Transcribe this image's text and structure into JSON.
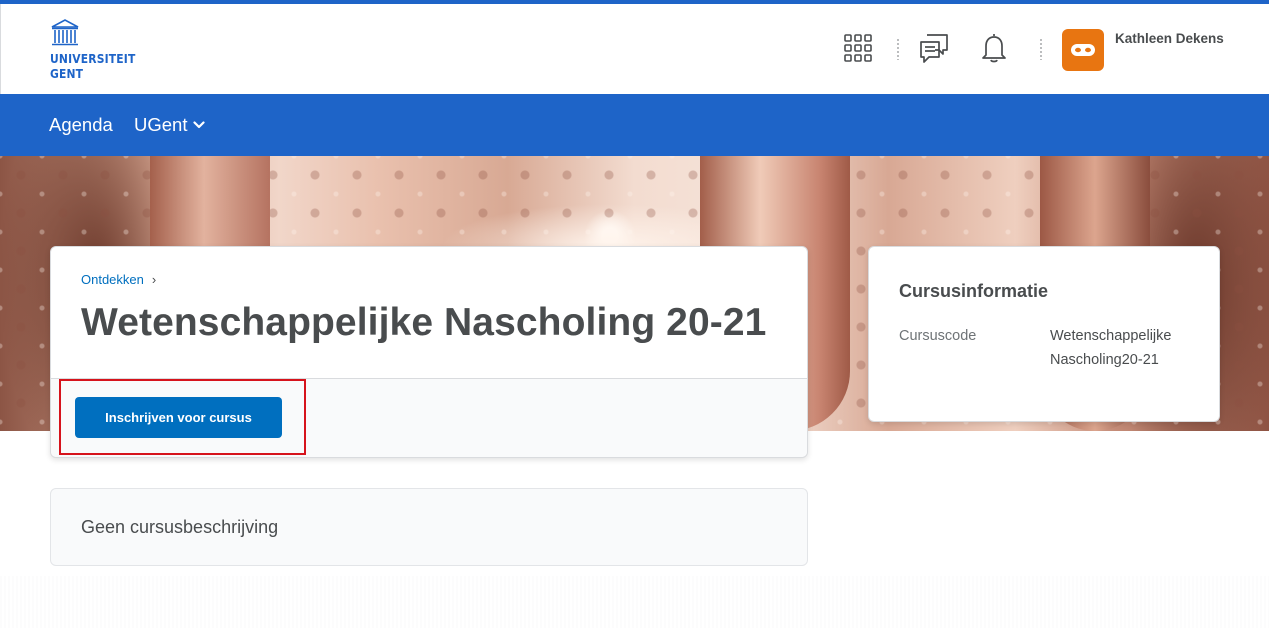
{
  "header": {
    "logo": {
      "line1": "UNIVERSITEIT",
      "line2": "GENT"
    },
    "icons": [
      "grid-icon",
      "chat-icon",
      "bell-icon"
    ],
    "user": {
      "name": "Kathleen Dekens",
      "avatar_color": "#e87511"
    }
  },
  "navbar": {
    "items": [
      {
        "label": "Agenda"
      },
      {
        "label": "UGent"
      }
    ],
    "color": "#1e64c8"
  },
  "course": {
    "breadcrumb": "Ontdekken",
    "breadcrumb_separator": "›",
    "title": "Wetenschappelijke Nascholing 20-21",
    "enroll_button": "Inschrijven voor cursus"
  },
  "info": {
    "title": "Cursusinformatie",
    "code_label": "Cursuscode",
    "code_value": "Wetenschappelijke Nascholing20-21"
  },
  "description": {
    "text": "Geen cursusbeschrijving"
  },
  "colors": {
    "accent": "#1e64c8",
    "button": "#006fbf",
    "highlight": "#d6131c"
  }
}
